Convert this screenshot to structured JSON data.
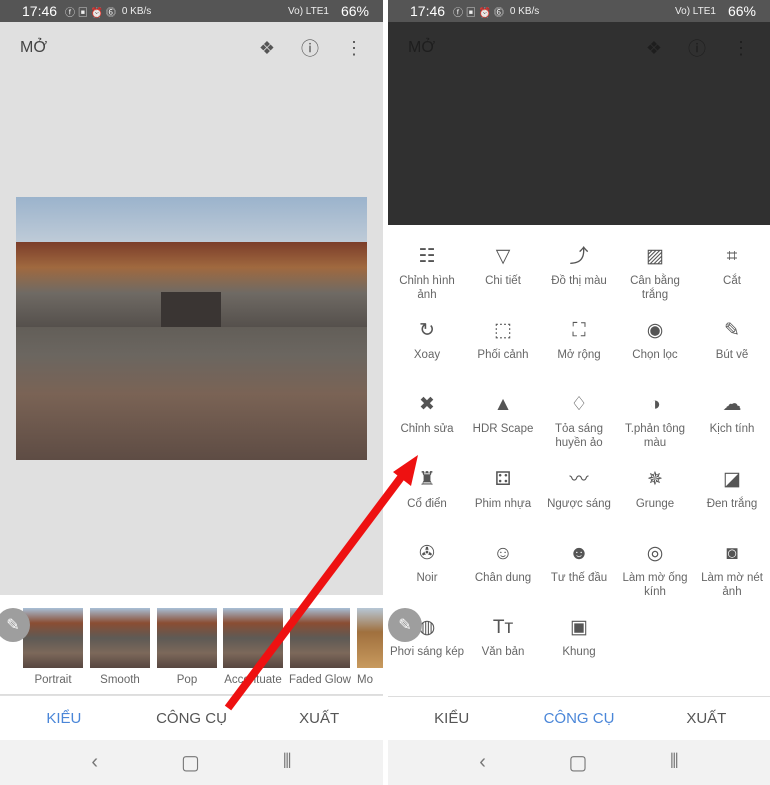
{
  "status": {
    "time": "17:46",
    "battery": "66%",
    "net_speed": "0 KB/s",
    "network": "Vo) LTE1"
  },
  "header": {
    "open_label": "MỞ"
  },
  "icons": {
    "layers": "layers-undo-icon",
    "info": "info-icon",
    "more": "more-vert-icon",
    "edit": "pencil-icon"
  },
  "styles": [
    {
      "label": "Portrait"
    },
    {
      "label": "Smooth"
    },
    {
      "label": "Pop"
    },
    {
      "label": "Accentuate"
    },
    {
      "label": "Faded Glow"
    },
    {
      "label": "Mo"
    }
  ],
  "tabs": {
    "styles": "KIỂU",
    "tools": "CÔNG CỤ",
    "export": "XUẤT"
  },
  "tools": [
    {
      "label": "Chỉnh hình ảnh",
      "icon": "tune-icon",
      "glyph": "☷"
    },
    {
      "label": "Chi tiết",
      "icon": "triangle-icon",
      "glyph": "▽"
    },
    {
      "label": "Đồ thị màu",
      "icon": "curves-icon",
      "glyph": "⤴"
    },
    {
      "label": "Cân bằng trắng",
      "icon": "white-balance-icon",
      "glyph": "▨"
    },
    {
      "label": "Cắt",
      "icon": "crop-icon",
      "glyph": "⌗"
    },
    {
      "label": "Xoay",
      "icon": "rotate-icon",
      "glyph": "↻"
    },
    {
      "label": "Phối cảnh",
      "icon": "perspective-icon",
      "glyph": "⬚"
    },
    {
      "label": "Mở rộng",
      "icon": "expand-icon",
      "glyph": "⛶"
    },
    {
      "label": "Chọn lọc",
      "icon": "selective-icon",
      "glyph": "◉"
    },
    {
      "label": "Bút vẽ",
      "icon": "brush-icon",
      "glyph": "✎"
    },
    {
      "label": "Chỉnh sửa",
      "icon": "healing-icon",
      "glyph": "✖"
    },
    {
      "label": "HDR Scape",
      "icon": "mountain-icon",
      "glyph": "▲"
    },
    {
      "label": "Tỏa sáng huyền ảo",
      "icon": "glamour-glow-icon",
      "glyph": "♢"
    },
    {
      "label": "T.phản tông màu",
      "icon": "tonal-contrast-icon",
      "glyph": "◑"
    },
    {
      "label": "Kịch tính",
      "icon": "drama-cloud-icon",
      "glyph": "☁"
    },
    {
      "label": "Cổ điển",
      "icon": "lamp-icon",
      "glyph": "♜"
    },
    {
      "label": "Phim nhựa",
      "icon": "grainy-film-icon",
      "glyph": "⚃"
    },
    {
      "label": "Ngược sáng",
      "icon": "mustache-icon",
      "glyph": "〰"
    },
    {
      "label": "Grunge",
      "icon": "grunge-icon",
      "glyph": "✵"
    },
    {
      "label": "Đen trắng",
      "icon": "black-white-icon",
      "glyph": "◪"
    },
    {
      "label": "Noir",
      "icon": "film-reel-icon",
      "glyph": "✇"
    },
    {
      "label": "Chân dung",
      "icon": "face-icon",
      "glyph": "☺"
    },
    {
      "label": "Tư thế đầu",
      "icon": "head-pose-icon",
      "glyph": "☻"
    },
    {
      "label": "Làm mờ ống kính",
      "icon": "lens-blur-icon",
      "glyph": "◎"
    },
    {
      "label": "Làm mờ nét ảnh",
      "icon": "vignette-icon",
      "glyph": "◙"
    },
    {
      "label": "Phơi sáng kép",
      "icon": "double-exposure-icon",
      "glyph": "◍"
    },
    {
      "label": "Văn bản",
      "icon": "text-icon",
      "glyph": "Tт"
    },
    {
      "label": "Khung",
      "icon": "frame-icon",
      "glyph": "▣"
    }
  ],
  "colors": {
    "accent": "#4a86d8",
    "arrow": "#ee1111"
  }
}
